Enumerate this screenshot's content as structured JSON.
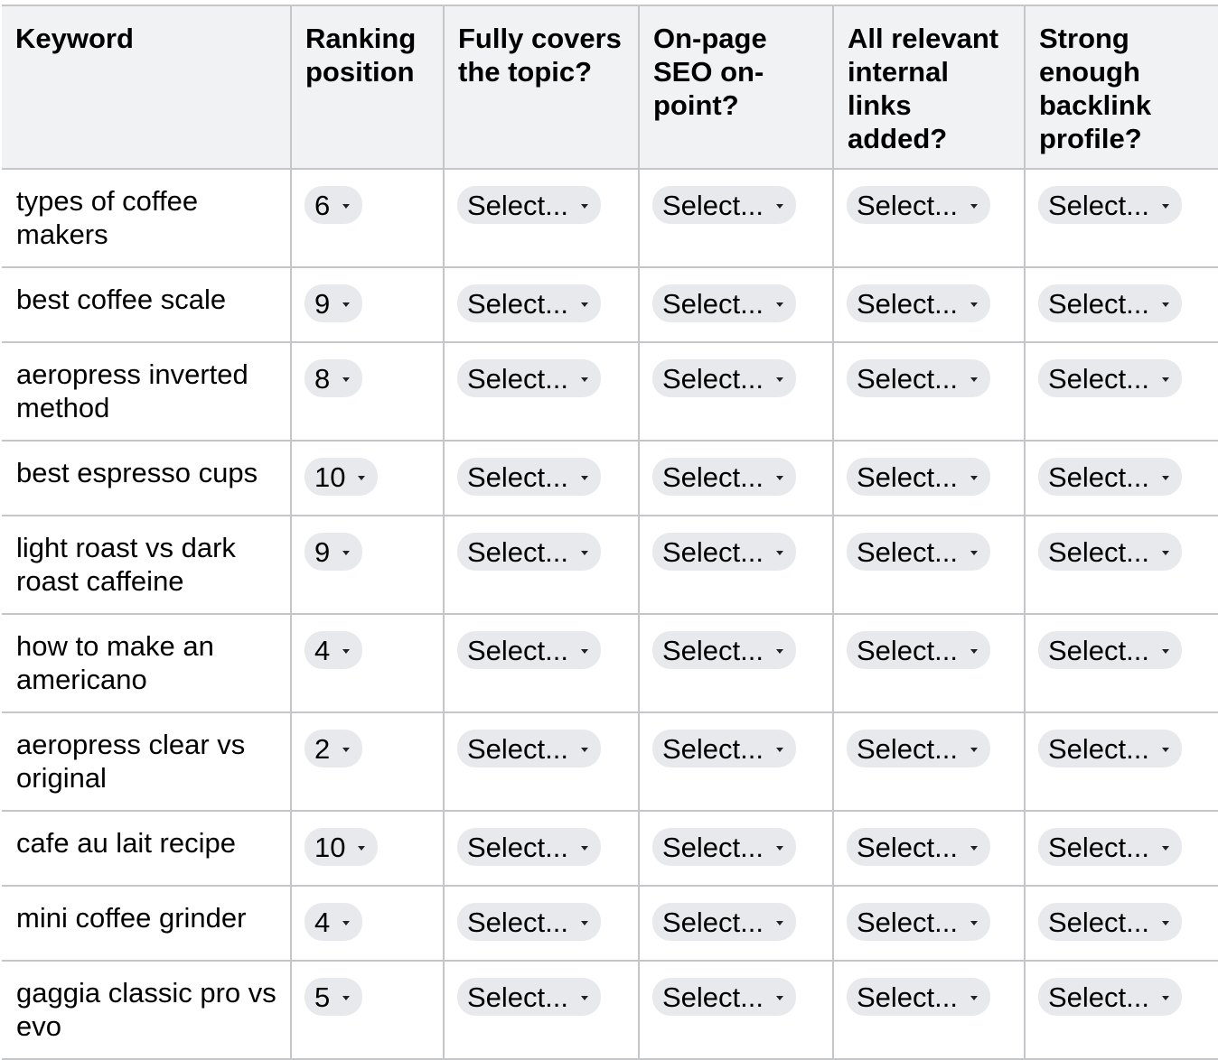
{
  "headers": [
    "Keyword",
    "Ranking position",
    "Fully covers the topic?",
    "On-page SEO on-point?",
    "All relevant internal links added?",
    "Strong enough backlink profile?"
  ],
  "select_placeholder": "Select...",
  "rows": [
    {
      "keyword": "types of coffee makers",
      "ranking": "6",
      "fully_covers": "Select...",
      "onpage_seo": "Select...",
      "internal_links": "Select...",
      "backlinks": "Select..."
    },
    {
      "keyword": "best coffee scale",
      "ranking": "9",
      "fully_covers": "Select...",
      "onpage_seo": "Select...",
      "internal_links": "Select...",
      "backlinks": "Select..."
    },
    {
      "keyword": "aeropress inverted method",
      "ranking": "8",
      "fully_covers": "Select...",
      "onpage_seo": "Select...",
      "internal_links": "Select...",
      "backlinks": "Select..."
    },
    {
      "keyword": "best espresso cups",
      "ranking": "10",
      "fully_covers": "Select...",
      "onpage_seo": "Select...",
      "internal_links": "Select...",
      "backlinks": "Select..."
    },
    {
      "keyword": "light roast vs dark roast caffeine",
      "ranking": "9",
      "fully_covers": "Select...",
      "onpage_seo": "Select...",
      "internal_links": "Select...",
      "backlinks": "Select..."
    },
    {
      "keyword": "how to make an americano",
      "ranking": "4",
      "fully_covers": "Select...",
      "onpage_seo": "Select...",
      "internal_links": "Select...",
      "backlinks": "Select..."
    },
    {
      "keyword": "aeropress clear vs original",
      "ranking": "2",
      "fully_covers": "Select...",
      "onpage_seo": "Select...",
      "internal_links": "Select...",
      "backlinks": "Select..."
    },
    {
      "keyword": "cafe au lait recipe",
      "ranking": "10",
      "fully_covers": "Select...",
      "onpage_seo": "Select...",
      "internal_links": "Select...",
      "backlinks": "Select..."
    },
    {
      "keyword": "mini coffee grinder",
      "ranking": "4",
      "fully_covers": "Select...",
      "onpage_seo": "Select...",
      "internal_links": "Select...",
      "backlinks": "Select..."
    },
    {
      "keyword": "gaggia classic pro vs evo",
      "ranking": "5",
      "fully_covers": "Select...",
      "onpage_seo": "Select...",
      "internal_links": "Select...",
      "backlinks": "Select..."
    }
  ],
  "colors": {
    "header_bg": "#f1f2f4",
    "border": "#c4c6ca",
    "chip_bg": "#e8e9ec"
  }
}
